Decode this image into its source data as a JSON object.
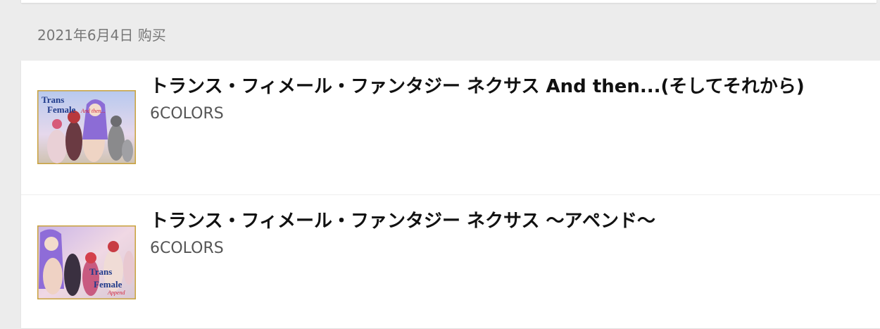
{
  "date_group": {
    "label": "2021年6月4日 购买"
  },
  "purchases": [
    {
      "title": "トランス・フィメール・ファンタジー ネクサス And then...(そしてそれから)",
      "circle": "6COLORS",
      "thumbnail": {
        "logo_line1": "Trans",
        "logo_line2": "Female",
        "logo_sub": "And then..."
      }
    },
    {
      "title": "トランス・フィメール・ファンタジー ネクサス ～アペンド～",
      "circle": "6COLORS",
      "thumbnail": {
        "logo_line1": "Trans",
        "logo_line2": "Female",
        "logo_sub": "Append"
      }
    }
  ]
}
